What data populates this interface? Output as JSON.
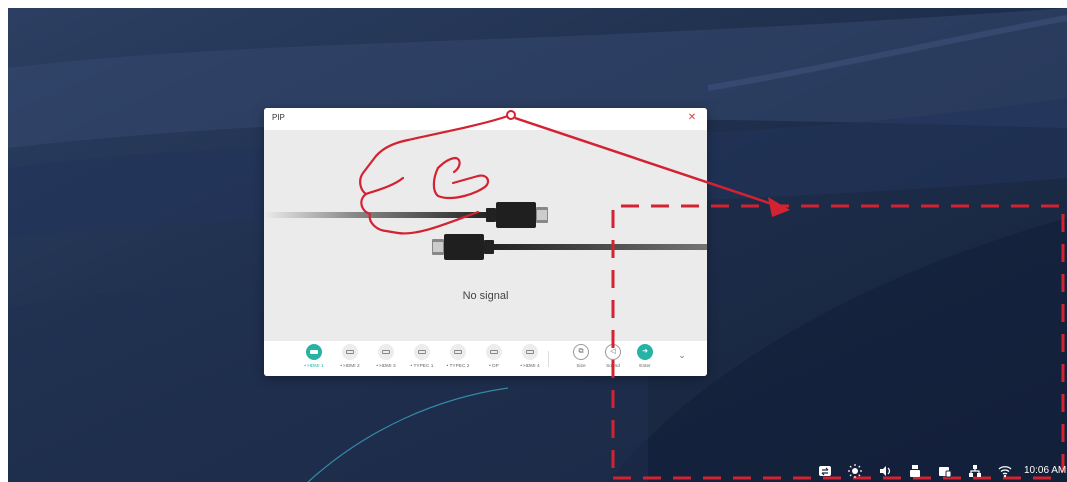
{
  "pip": {
    "title": "PIP",
    "close_icon": "close-icon",
    "no_signal": "No signal",
    "sources": [
      {
        "label": "• HDMI 1",
        "icon": "hdmi-port-icon",
        "active": true
      },
      {
        "label": "• HDMI 2",
        "icon": "hdmi-port-icon",
        "active": false
      },
      {
        "label": "• HDMI 3",
        "icon": "hdmi-port-icon",
        "active": false
      },
      {
        "label": "• TYPEC 1",
        "icon": "usb-c-port-icon",
        "active": false
      },
      {
        "label": "• TYPEC 2",
        "icon": "usb-c-port-icon",
        "active": false
      },
      {
        "label": "• DP",
        "icon": "displayport-icon",
        "active": false
      },
      {
        "label": "• HDMI 4",
        "icon": "hdmi-port-icon",
        "active": false
      }
    ],
    "actions": [
      {
        "label": "Size",
        "icon": "size-icon"
      },
      {
        "label": "Sound",
        "icon": "speaker-icon"
      },
      {
        "label": "Enter",
        "icon": "enter-arrow-icon"
      }
    ],
    "expand_icon": "chevron-down-icon"
  },
  "taskbar": {
    "icons": [
      "switch-icon",
      "brightness-icon",
      "volume-icon",
      "usb-icon",
      "window-icon",
      "network-icon",
      "wifi-icon"
    ],
    "time": "10:06 AM"
  },
  "colors": {
    "accent": "#26b3a5",
    "annotation_red": "#d32231",
    "desktop": "#1a2a45"
  }
}
